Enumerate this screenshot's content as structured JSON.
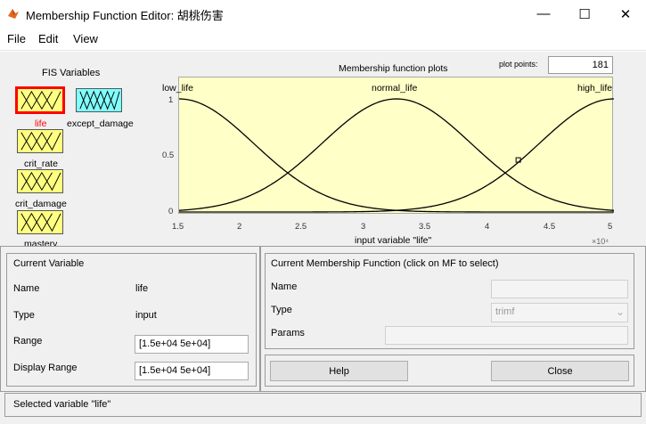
{
  "window": {
    "title": "Membership Function Editor: 胡桃伤害",
    "minimize_glyph": "—",
    "maximize_glyph": "☐",
    "close_glyph": "✕"
  },
  "menu": [
    "File",
    "Edit",
    "View"
  ],
  "fis_variables": {
    "heading": "FIS Variables",
    "items": [
      {
        "label": "life",
        "kind": "input",
        "selected": true
      },
      {
        "label": "except_damage",
        "kind": "output",
        "selected": false
      },
      {
        "label": "crit_rate",
        "kind": "input",
        "selected": false
      },
      {
        "label": "crit_damage",
        "kind": "input",
        "selected": false
      },
      {
        "label": "mastery",
        "kind": "input",
        "selected": false
      }
    ]
  },
  "plot": {
    "title": "Membership function plots",
    "points_label": "plot points:",
    "points_value": "181",
    "mf_labels": [
      "low_life",
      "normal_life",
      "high_life"
    ],
    "y_ticks": [
      "1",
      "0.5",
      "0"
    ],
    "x_ticks": [
      "1.5",
      "2",
      "2.5",
      "3",
      "3.5",
      "4",
      "4.5",
      "5"
    ],
    "x_label": "input variable \"life\"",
    "x_exponent": "×10⁴",
    "colors": {
      "background": "#ffffc8",
      "curve": "#000000"
    }
  },
  "chart_data": {
    "type": "line",
    "title": "Membership function plots",
    "xlabel": "input variable \"life\"",
    "ylabel": "",
    "xlim": [
      15000,
      50000
    ],
    "ylim": [
      0,
      1
    ],
    "series": [
      {
        "name": "low_life",
        "shape": "gauss",
        "center": 15000,
        "sigma": 6000
      },
      {
        "name": "normal_life",
        "shape": "gauss",
        "center": 32500,
        "sigma": 6000
      },
      {
        "name": "high_life",
        "shape": "gauss",
        "center": 50000,
        "sigma": 6000
      }
    ],
    "marker": {
      "x": 42300,
      "y": 0.46
    }
  },
  "current_variable": {
    "heading": "Current Variable",
    "name_label": "Name",
    "name_value": "life",
    "type_label": "Type",
    "type_value": "input",
    "range_label": "Range",
    "range_value": "[1.5e+04 5e+04]",
    "display_range_label": "Display Range",
    "display_range_value": "[1.5e+04 5e+04]"
  },
  "current_mf": {
    "heading": "Current Membership Function (click on MF to select)",
    "name_label": "Name",
    "name_value": "",
    "type_label": "Type",
    "type_value": "trimf",
    "params_label": "Params",
    "params_value": ""
  },
  "buttons": {
    "help": "Help",
    "close": "Close"
  },
  "status": "Selected variable \"life\""
}
